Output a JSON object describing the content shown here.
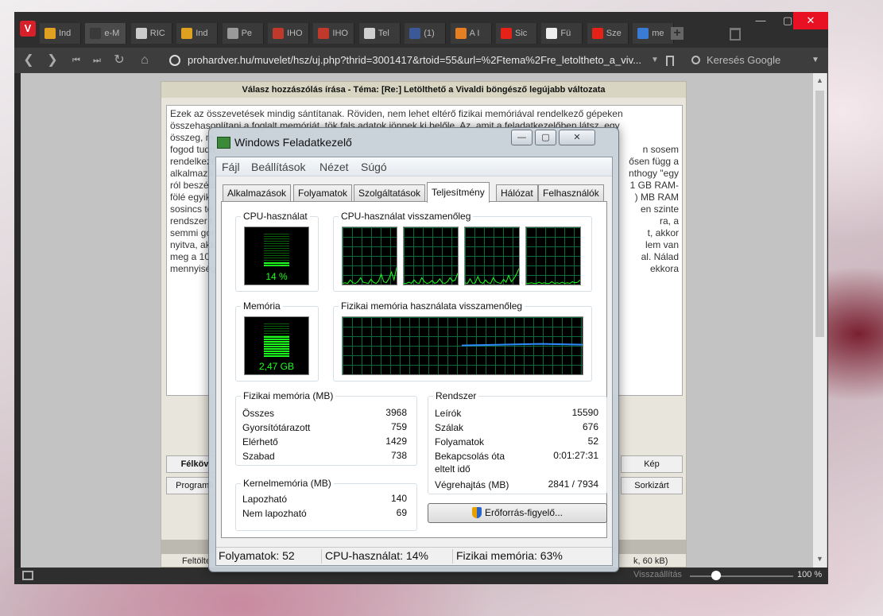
{
  "browser": {
    "tabs": [
      {
        "label": "Ind",
        "color": "#e0a020"
      },
      {
        "label": "e-M",
        "color": "#3a3a3a"
      },
      {
        "label": "RIC",
        "color": "#cccccc"
      },
      {
        "label": "Ind",
        "color": "#e0a020"
      },
      {
        "label": "Pe",
        "color": "#9a9a9a"
      },
      {
        "label": "IHO",
        "color": "#c0392b"
      },
      {
        "label": "IHO",
        "color": "#c0392b"
      },
      {
        "label": "Tel",
        "color": "#d0d0d0"
      },
      {
        "label": "(1)",
        "color": "#3b5998"
      },
      {
        "label": "A I",
        "color": "#e67e22"
      },
      {
        "label": "Sic",
        "color": "#e62117"
      },
      {
        "label": "Fü",
        "color": "#eeeeee"
      },
      {
        "label": "Sze",
        "color": "#e62117"
      },
      {
        "label": "me",
        "color": "#3a7bd5"
      }
    ],
    "url": "prohardver.hu/muvelet/hsz/uj.php?thrid=3001417&rtoid=55&url=%2Ftema%2Fre_letoltheto_a_viv...",
    "search_placeholder": "Keresés Google",
    "status_reset": "Visszaállítás",
    "zoom": "100 %"
  },
  "page": {
    "title": "Válasz hozzászólás írása - Téma: [Re:] Letölthető a Vivaldi böngésző legújabb változata",
    "lines": [
      "Ezek az összevetések mindig sántítanak. Röviden, nem lehet eltérő fizikai memóriával rendelkező gépeken",
      "összehasonlítani a foglalt memóriát, tök fals adatok jönnek ki belőle. Az, amit a feladatkezelőben látsz, egy",
      "összeg, m",
      "fogod tudn",
      "rendelkezé",
      "alkalmazá",
      "ról beszélü",
      "fölé egyik",
      "sosincs te",
      "rendszer t",
      "semmi gor",
      "nyitva, akk",
      "meg a 10",
      "mennyiség"
    ],
    "right_lines": [
      "",
      "",
      "",
      "n sosem",
      "ősen függ a",
      "nthogy \"egy",
      "1 GB RAM-",
      ") MB RAM",
      "en szinte",
      "ra, a",
      "t, akkor",
      "lem van",
      "al. Nálad",
      "ekkora"
    ],
    "btn_felkov": "Félköv",
    "btn_kep": "Kép",
    "btn_programk": "Programk",
    "btn_sorkizart": "Sorkizárt",
    "status_left": "Feltölte",
    "status_right": "k, 60 kB)"
  },
  "tm": {
    "title": "Windows Feladatkezelő",
    "menu": [
      "Fájl",
      "Beállítások",
      "Nézet",
      "Súgó"
    ],
    "tabs": [
      "Alkalmazások",
      "Folyamatok",
      "Szolgáltatások",
      "Teljesítmény",
      "Hálózat",
      "Felhasználók"
    ],
    "active_tab": "Teljesítmény",
    "cpu_label": "CPU-használat",
    "cpu_value": "14 %",
    "cpu_fraction": 0.14,
    "cpu_history_label": "CPU-használat visszamenőleg",
    "mem_label": "Memória",
    "mem_value": "2,47 GB",
    "mem_fraction": 0.63,
    "mem_history_label": "Fizikai memória használata visszamenőleg",
    "mem_history_level": 0.52,
    "physical": {
      "label": "Fizikai memória (MB)",
      "rows": [
        {
          "name": "Összes",
          "value": "3968"
        },
        {
          "name": "Gyorsítótárazott",
          "value": "759"
        },
        {
          "name": "Elérhető",
          "value": "1429"
        },
        {
          "name": "Szabad",
          "value": "738"
        }
      ]
    },
    "kernel": {
      "label": "Kernelmemória (MB)",
      "rows": [
        {
          "name": "Lapozható",
          "value": "140"
        },
        {
          "name": "Nem lapozható",
          "value": "69"
        }
      ]
    },
    "system": {
      "label": "Rendszer",
      "rows": [
        {
          "name": "Leírók",
          "value": "15590"
        },
        {
          "name": "Szálak",
          "value": "676"
        },
        {
          "name": "Folyamatok",
          "value": "52"
        },
        {
          "name": "Bekapcsolás óta\neltelt idő",
          "value": "0:01:27:31"
        },
        {
          "name": "Végrehajtás (MB)",
          "value": "2841 / 7934"
        }
      ]
    },
    "resource_button": "Erőforrás-figyelő...",
    "status": {
      "processes": "Folyamatok: 52",
      "cpu": "CPU-használat: 14%",
      "memory": "Fizikai memória: 63%"
    },
    "cpu_history": [
      [
        0.02,
        0.03,
        0.02,
        0.08,
        0.03,
        0.02,
        0.05,
        0.12,
        0.04,
        0.03,
        0.02,
        0.09,
        0.04,
        0.02,
        0.06,
        0.18,
        0.05,
        0.03,
        0.1,
        0.22,
        0.08,
        0.3
      ],
      [
        0.02,
        0.02,
        0.04,
        0.02,
        0.08,
        0.03,
        0.02,
        0.12,
        0.05,
        0.02,
        0.03,
        0.07,
        0.02,
        0.04,
        0.1,
        0.03,
        0.02,
        0.05,
        0.12,
        0.06,
        0.08,
        0.2
      ],
      [
        0.03,
        0.02,
        0.1,
        0.02,
        0.03,
        0.14,
        0.04,
        0.02,
        0.08,
        0.03,
        0.02,
        0.12,
        0.05,
        0.03,
        0.02,
        0.09,
        0.04,
        0.16,
        0.05,
        0.1,
        0.18,
        0.28
      ],
      [
        0.02,
        0.02,
        0.03,
        0.02,
        0.02,
        0.04,
        0.02,
        0.03,
        0.02,
        0.02,
        0.05,
        0.02,
        0.03,
        0.02,
        0.04,
        0.02,
        0.03,
        0.02,
        0.05,
        0.03,
        0.04,
        0.08
      ]
    ]
  }
}
